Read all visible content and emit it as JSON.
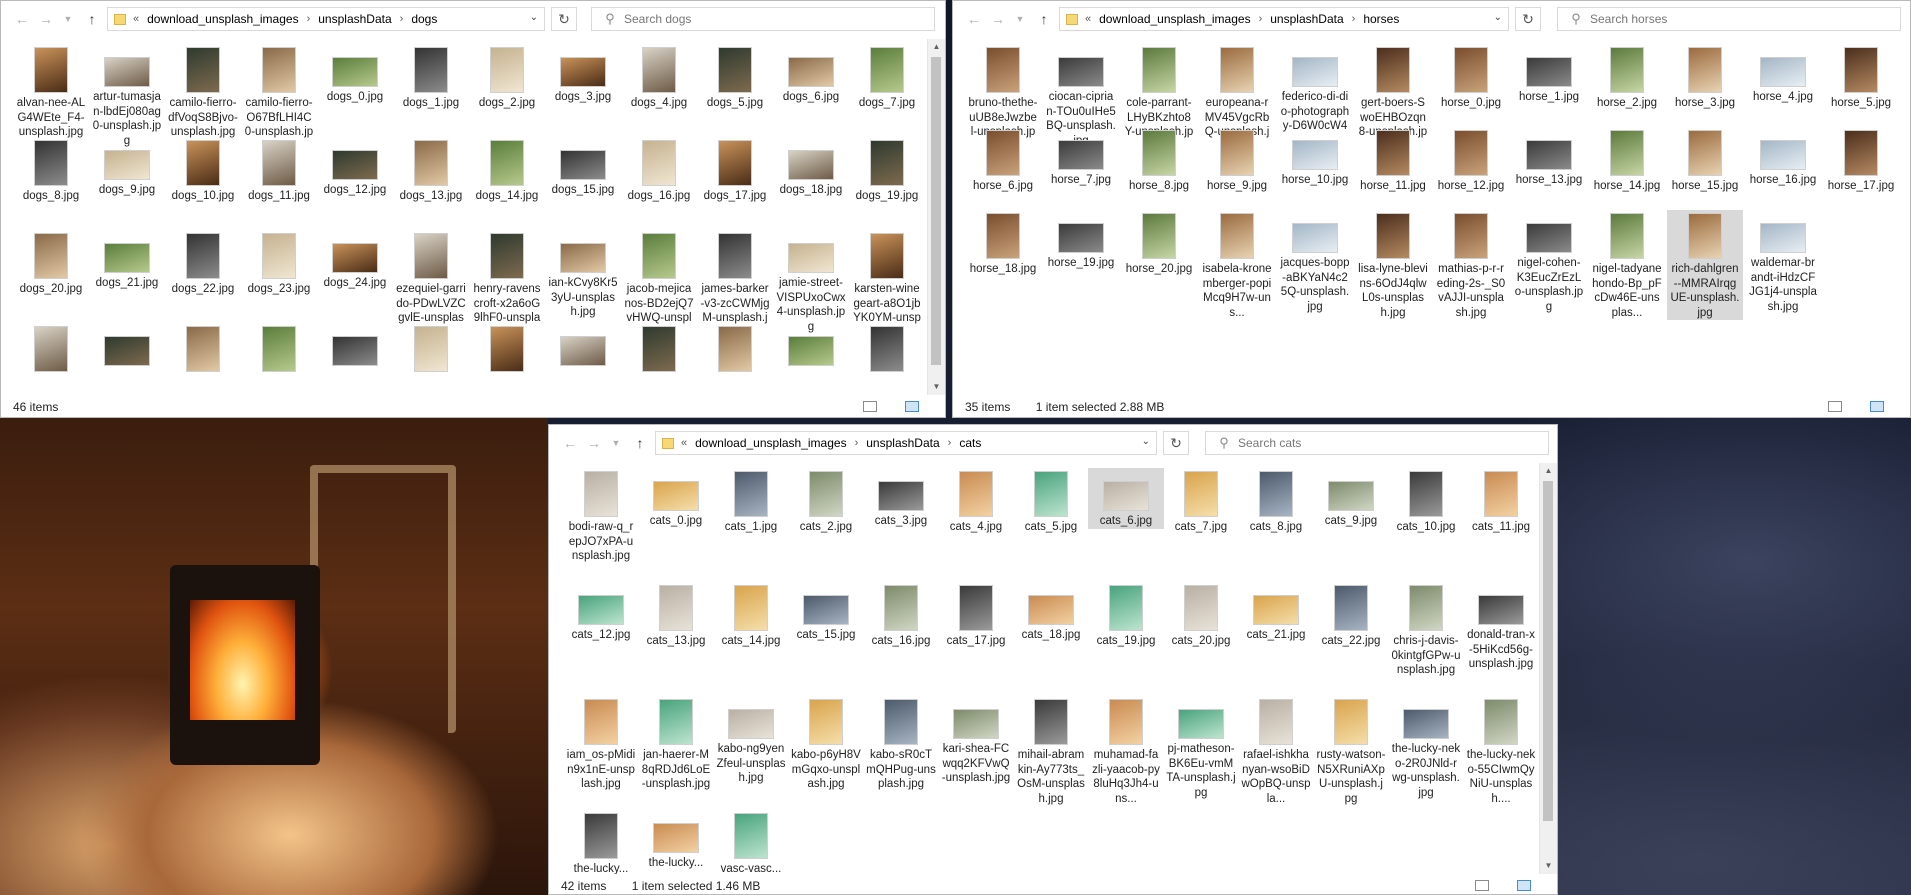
{
  "desktop": {
    "wallpaper": "fireplace-and-night-sky"
  },
  "dogs_window": {
    "path": [
      "download_unsplash_images",
      "unsplashData",
      "dogs"
    ],
    "search_placeholder": "Search dogs",
    "status_count": "46 items",
    "status_selection": "",
    "files": [
      "alvan-nee-ALG4WEte_F4-unsplash.jpg",
      "artur-tumasjan-lbdEj080ag0-unsplash.jpg",
      "camilo-fierro-dfVoqS8Bjvo-unsplash.jpg",
      "camilo-fierro-O67BfLHI4C0-unsplash.jpg",
      "dogs_0.jpg",
      "dogs_1.jpg",
      "dogs_2.jpg",
      "dogs_3.jpg",
      "dogs_4.jpg",
      "dogs_5.jpg",
      "dogs_6.jpg",
      "dogs_7.jpg",
      "dogs_8.jpg",
      "dogs_9.jpg",
      "dogs_10.jpg",
      "dogs_11.jpg",
      "dogs_12.jpg",
      "dogs_13.jpg",
      "dogs_14.jpg",
      "dogs_15.jpg",
      "dogs_16.jpg",
      "dogs_17.jpg",
      "dogs_18.jpg",
      "dogs_19.jpg",
      "dogs_20.jpg",
      "dogs_21.jpg",
      "dogs_22.jpg",
      "dogs_23.jpg",
      "dogs_24.jpg",
      "ezequiel-garrido-PDwLVZCgvlE-unsplash.jpg",
      "henry-ravenscroft-x2a6oG9lhF0-unsplash.jpg",
      "ian-kCvy8Kr53yU-unsplash.jpg",
      "jacob-mejicanos-BD2ejQ7vHWQ-unsplas...",
      "james-barker-v3-zcCWMjgM-unsplash.jpg",
      "jamie-street-VISPUxoCwx4-unsplash.jpg",
      "karsten-winegeart-a8O1jbYK0YM-unspl...",
      "",
      "",
      "",
      "",
      "",
      "",
      "",
      "",
      "",
      "",
      "",
      ""
    ]
  },
  "horses_window": {
    "path": [
      "download_unsplash_images",
      "unsplashData",
      "horses"
    ],
    "search_placeholder": "Search horses",
    "status_count": "35 items",
    "status_selection": "1 item selected  2.88 MB",
    "files": [
      "bruno-thethe-uUB8eJwzbel-unsplash.jpg",
      "ciocan-ciprian-TOu0uIHe5BQ-unsplash.jpg",
      "cole-parrant-LHyBKzhto8Y-unsplash.jpg",
      "europeana-rMV45VgcRbQ-unsplash.jpg",
      "federico-di-dio-photography-D6W0cW4_...",
      "gert-boers-SwoEHBOzqn8-unsplash.jpg",
      "horse_0.jpg",
      "horse_1.jpg",
      "horse_2.jpg",
      "horse_3.jpg",
      "horse_4.jpg",
      "horse_5.jpg",
      "horse_6.jpg",
      "horse_7.jpg",
      "horse_8.jpg",
      "horse_9.jpg",
      "horse_10.jpg",
      "horse_11.jpg",
      "horse_12.jpg",
      "horse_13.jpg",
      "horse_14.jpg",
      "horse_15.jpg",
      "horse_16.jpg",
      "horse_17.jpg",
      "horse_18.jpg",
      "horse_19.jpg",
      "horse_20.jpg",
      "isabela-kronemberger-popiMcq9H7w-uns...",
      "jacques-bopp-aBKYaN4c25Q-unsplash.jpg",
      "lisa-lyne-blevins-6OdJ4qlwL0s-unsplash.jpg",
      "mathias-p-r-reding-2s-_S0vAJJI-unsplash.jpg",
      "nigel-cohen-K3EucZrEzLo-unsplash.jpg",
      "nigel-tadyanehondo-Bp_pFcDw46E-unsplas...",
      "rich-dahlgren--MMRAIrqgUE-unsplash.jpg",
      "waldemar-brandt-iHdzCFJG1j4-unsplash.jpg"
    ],
    "selected_index": 33
  },
  "cats_window": {
    "path": [
      "download_unsplash_images",
      "unsplashData",
      "cats"
    ],
    "search_placeholder": "Search cats",
    "status_count": "42 items",
    "status_selection": "1 item selected  1.46 MB",
    "files": [
      "bodi-raw-q_repJO7xPA-unsplash.jpg",
      "cats_0.jpg",
      "cats_1.jpg",
      "cats_2.jpg",
      "cats_3.jpg",
      "cats_4.jpg",
      "cats_5.jpg",
      "cats_6.jpg",
      "cats_7.jpg",
      "cats_8.jpg",
      "cats_9.jpg",
      "cats_10.jpg",
      "cats_11.jpg",
      "cats_12.jpg",
      "cats_13.jpg",
      "cats_14.jpg",
      "cats_15.jpg",
      "cats_16.jpg",
      "cats_17.jpg",
      "cats_18.jpg",
      "cats_19.jpg",
      "cats_20.jpg",
      "cats_21.jpg",
      "cats_22.jpg",
      "chris-j-davis-0kintgfGPw-unsplash.jpg",
      "donald-tran-x-5HiKcd56g-unsplash.jpg",
      "iam_os-pMidin9x1nE-unsplash.jpg",
      "jan-haerer-M8qRDJd6LoE-unsplash.jpg",
      "kabo-ng9yenZfeul-unsplash.jpg",
      "kabo-p6yH8VmGqxo-unsplash.jpg",
      "kabo-sR0cTmQHPug-unsplash.jpg",
      "kari-shea-FCwqq2KFVwQ-unsplash.jpg",
      "mihail-abramkin-Ay773ts_OsM-unsplash.jpg",
      "muhamad-fazli-yaacob-py8luHq3Jh4-uns...",
      "pj-matheson-BK6Eu-vmMTA-unsplash.jpg",
      "rafael-ishkhanyan-wsoBiDwOpBQ-unspla...",
      "rusty-watson-N5XRuniAXpU-unsplash.jpg",
      "the-lucky-neko-2R0JNld-rwg-unsplash.jpg",
      "the-lucky-neko-55CIwmQyNiU-unsplash....",
      "the-lucky...",
      "the-lucky...",
      "vasc-vasc..."
    ],
    "selected_index": 7
  }
}
